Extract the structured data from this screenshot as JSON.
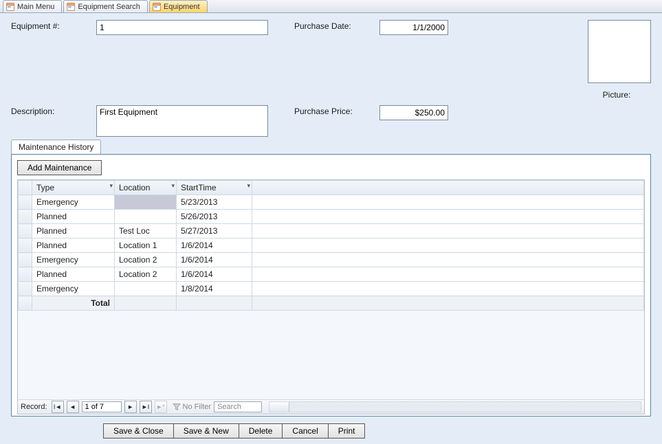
{
  "tabs": [
    {
      "label": "Main Menu",
      "active": false
    },
    {
      "label": "Equipment Search",
      "active": false
    },
    {
      "label": "Equipment",
      "active": true
    }
  ],
  "form": {
    "equipNumLabel": "Equipment #:",
    "equipNum": "1",
    "descLabel": "Description:",
    "desc": "First Equipment",
    "purchaseDateLabel": "Purchase Date:",
    "purchaseDate": "1/1/2000",
    "purchasePriceLabel": "Purchase Price:",
    "purchasePrice": "$250.00",
    "pictureLabel": "Picture:"
  },
  "subtab": {
    "label": "Maintenance History"
  },
  "addMaint": "Add Maintenance",
  "grid": {
    "cols": [
      "Type",
      "Location",
      "StartTime"
    ],
    "rows": [
      {
        "type": "Emergency",
        "loc": "",
        "start": "5/23/2013",
        "sel": true
      },
      {
        "type": "Planned",
        "loc": "",
        "start": "5/26/2013"
      },
      {
        "type": "Planned",
        "loc": "Test Loc",
        "start": "5/27/2013"
      },
      {
        "type": "Planned",
        "loc": "Location 1",
        "start": "1/6/2014"
      },
      {
        "type": "Emergency",
        "loc": "Location 2",
        "start": "1/6/2014"
      },
      {
        "type": "Planned",
        "loc": "Location 2",
        "start": "1/6/2014"
      },
      {
        "type": "Emergency",
        "loc": "",
        "start": "1/8/2014"
      }
    ],
    "totalLabel": "Total"
  },
  "nav": {
    "recordLabel": "Record:",
    "pos": "1 of 7",
    "noFilter": "No Filter",
    "searchPlaceholder": "Search"
  },
  "actions": {
    "saveClose": "Save & Close",
    "saveNew": "Save & New",
    "delete": "Delete",
    "cancel": "Cancel",
    "print": "Print"
  }
}
